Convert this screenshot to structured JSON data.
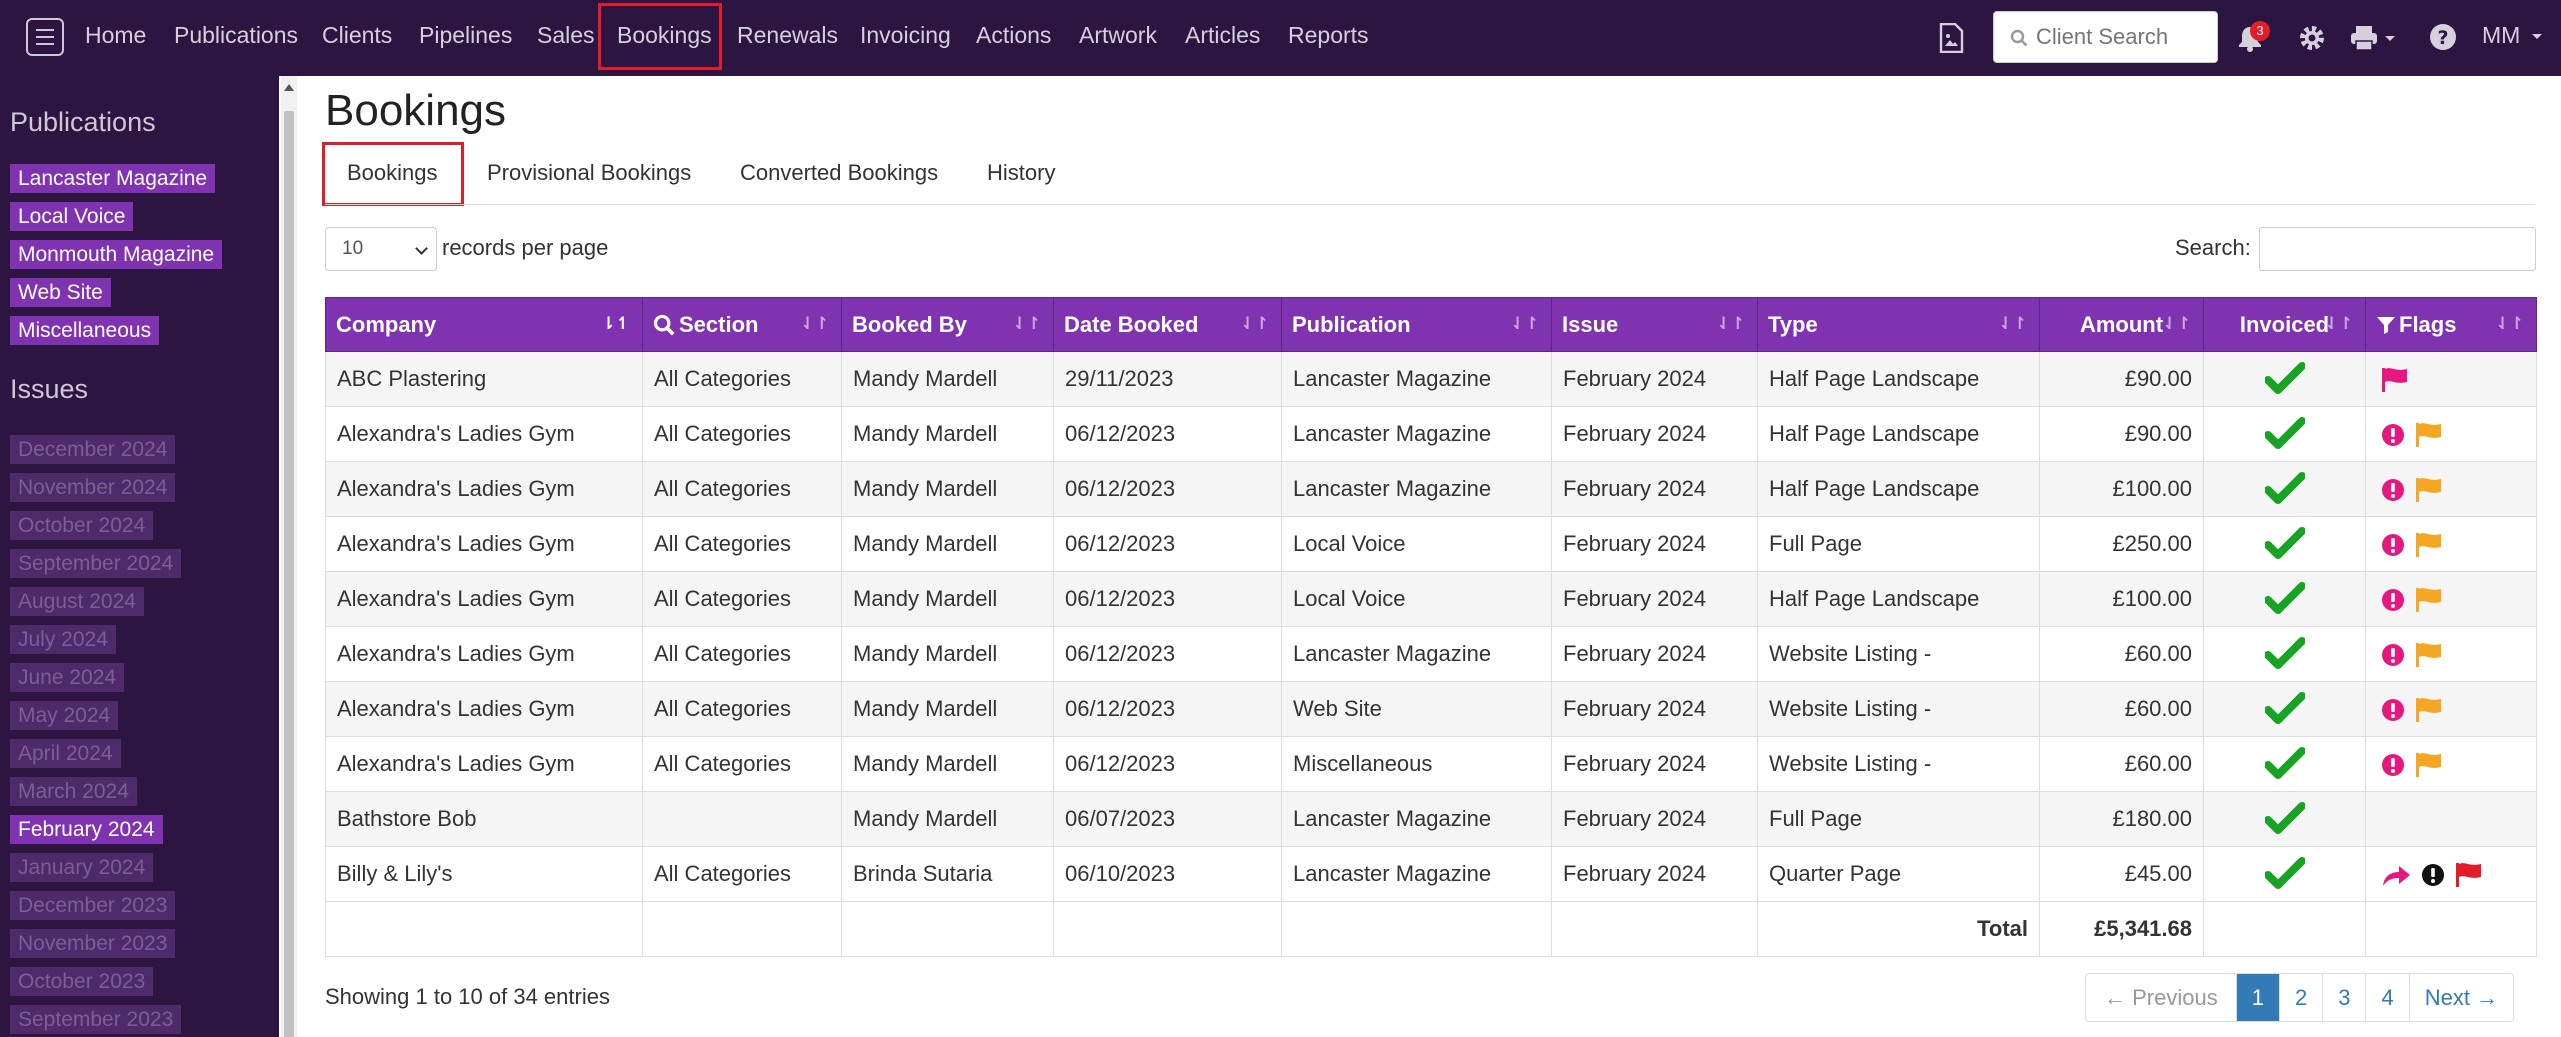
{
  "nav": {
    "items": [
      "Home",
      "Publications",
      "Clients",
      "Pipelines",
      "Sales",
      "Bookings",
      "Renewals",
      "Invoicing",
      "Actions",
      "Artwork",
      "Articles",
      "Reports"
    ],
    "client_search_placeholder": "Client Search",
    "notification_count": "3",
    "user_initials": "MM",
    "icons": [
      "menu-icon",
      "image-document-icon",
      "search-icon",
      "bell-icon",
      "gear-icon",
      "print-icon",
      "help-icon"
    ]
  },
  "sidebar": {
    "publications_heading": "Publications",
    "publications": [
      "Lancaster Magazine",
      "Local Voice",
      "Monmouth Magazine",
      "Web Site",
      "Miscellaneous"
    ],
    "issues_heading": "Issues",
    "issues": [
      "December 2024",
      "November 2024",
      "October 2024",
      "September 2024",
      "August 2024",
      "July 2024",
      "June 2024",
      "May 2024",
      "April 2024",
      "March 2024",
      "February 2024",
      "January 2024",
      "December 2023",
      "November 2023",
      "October 2023",
      "September 2023"
    ],
    "active_issue": "February 2024"
  },
  "page": {
    "title": "Bookings",
    "tabs": [
      "Bookings",
      "Provisional Bookings",
      "Converted Bookings",
      "History"
    ],
    "active_tab": "Bookings",
    "records_per_page_value": "10",
    "records_per_page_label": "records per page",
    "search_label": "Search:"
  },
  "table": {
    "columns": [
      "Company",
      "Section",
      "Booked By",
      "Date Booked",
      "Publication",
      "Issue",
      "Type",
      "Amount",
      "Invoiced",
      "Flags"
    ],
    "rows": [
      {
        "company": "ABC Plastering",
        "section": "All Categories",
        "booked_by": "Mandy Mardell",
        "date": "29/11/2023",
        "publication": "Lancaster Magazine",
        "issue": "February 2024",
        "type": "Half Page Landscape",
        "amount": "£90.00",
        "invoiced": true,
        "flags": [
          "pink-flag-icon"
        ]
      },
      {
        "company": "Alexandra's Ladies Gym",
        "section": "All Categories",
        "booked_by": "Mandy Mardell",
        "date": "06/12/2023",
        "publication": "Lancaster Magazine",
        "issue": "February 2024",
        "type": "Half Page Landscape",
        "amount": "£90.00",
        "invoiced": true,
        "flags": [
          "pink-alert-icon",
          "orange-flag-icon"
        ]
      },
      {
        "company": "Alexandra's Ladies Gym",
        "section": "All Categories",
        "booked_by": "Mandy Mardell",
        "date": "06/12/2023",
        "publication": "Lancaster Magazine",
        "issue": "February 2024",
        "type": "Half Page Landscape",
        "amount": "£100.00",
        "invoiced": true,
        "flags": [
          "pink-alert-icon",
          "orange-flag-icon"
        ]
      },
      {
        "company": "Alexandra's Ladies Gym",
        "section": "All Categories",
        "booked_by": "Mandy Mardell",
        "date": "06/12/2023",
        "publication": "Local Voice",
        "issue": "February 2024",
        "type": "Full Page",
        "amount": "£250.00",
        "invoiced": true,
        "flags": [
          "pink-alert-icon",
          "orange-flag-icon"
        ]
      },
      {
        "company": "Alexandra's Ladies Gym",
        "section": "All Categories",
        "booked_by": "Mandy Mardell",
        "date": "06/12/2023",
        "publication": "Local Voice",
        "issue": "February 2024",
        "type": "Half Page Landscape",
        "amount": "£100.00",
        "invoiced": true,
        "flags": [
          "pink-alert-icon",
          "orange-flag-icon"
        ]
      },
      {
        "company": "Alexandra's Ladies Gym",
        "section": "All Categories",
        "booked_by": "Mandy Mardell",
        "date": "06/12/2023",
        "publication": "Lancaster Magazine",
        "issue": "February 2024",
        "type": "Website Listing -",
        "amount": "£60.00",
        "invoiced": true,
        "flags": [
          "pink-alert-icon",
          "orange-flag-icon"
        ]
      },
      {
        "company": "Alexandra's Ladies Gym",
        "section": "All Categories",
        "booked_by": "Mandy Mardell",
        "date": "06/12/2023",
        "publication": "Web Site",
        "issue": "February 2024",
        "type": "Website Listing -",
        "amount": "£60.00",
        "invoiced": true,
        "flags": [
          "pink-alert-icon",
          "orange-flag-icon"
        ]
      },
      {
        "company": "Alexandra's Ladies Gym",
        "section": "All Categories",
        "booked_by": "Mandy Mardell",
        "date": "06/12/2023",
        "publication": "Miscellaneous",
        "issue": "February 2024",
        "type": "Website Listing -",
        "amount": "£60.00",
        "invoiced": true,
        "flags": [
          "pink-alert-icon",
          "orange-flag-icon"
        ]
      },
      {
        "company": "Bathstore Bob",
        "section": "",
        "booked_by": "Mandy Mardell",
        "date": "06/07/2023",
        "publication": "Lancaster Magazine",
        "issue": "February 2024",
        "type": "Full Page",
        "amount": "£180.00",
        "invoiced": true,
        "flags": []
      },
      {
        "company": "Billy & Lily's",
        "section": "All Categories",
        "booked_by": "Brinda Sutaria",
        "date": "06/10/2023",
        "publication": "Lancaster Magazine",
        "issue": "February 2024",
        "type": "Quarter Page",
        "amount": "£45.00",
        "invoiced": true,
        "flags": [
          "pink-share-icon",
          "black-alert-icon",
          "red-flag-icon"
        ]
      }
    ],
    "total_label": "Total",
    "total_value": "£5,341.68"
  },
  "footer": {
    "showing_text": "Showing 1 to 10 of 34 entries",
    "pagination": [
      "← Previous",
      "1",
      "2",
      "3",
      "4",
      "Next →"
    ],
    "active_page": "1"
  },
  "colors": {
    "nav_bg": "#2d1541",
    "accent_purple": "#8033b1",
    "check_green": "#17a324",
    "flag_pink": "#e8177f",
    "flag_orange": "#f5a623",
    "flag_red": "#e21c28",
    "page_blue": "#337ab7"
  }
}
